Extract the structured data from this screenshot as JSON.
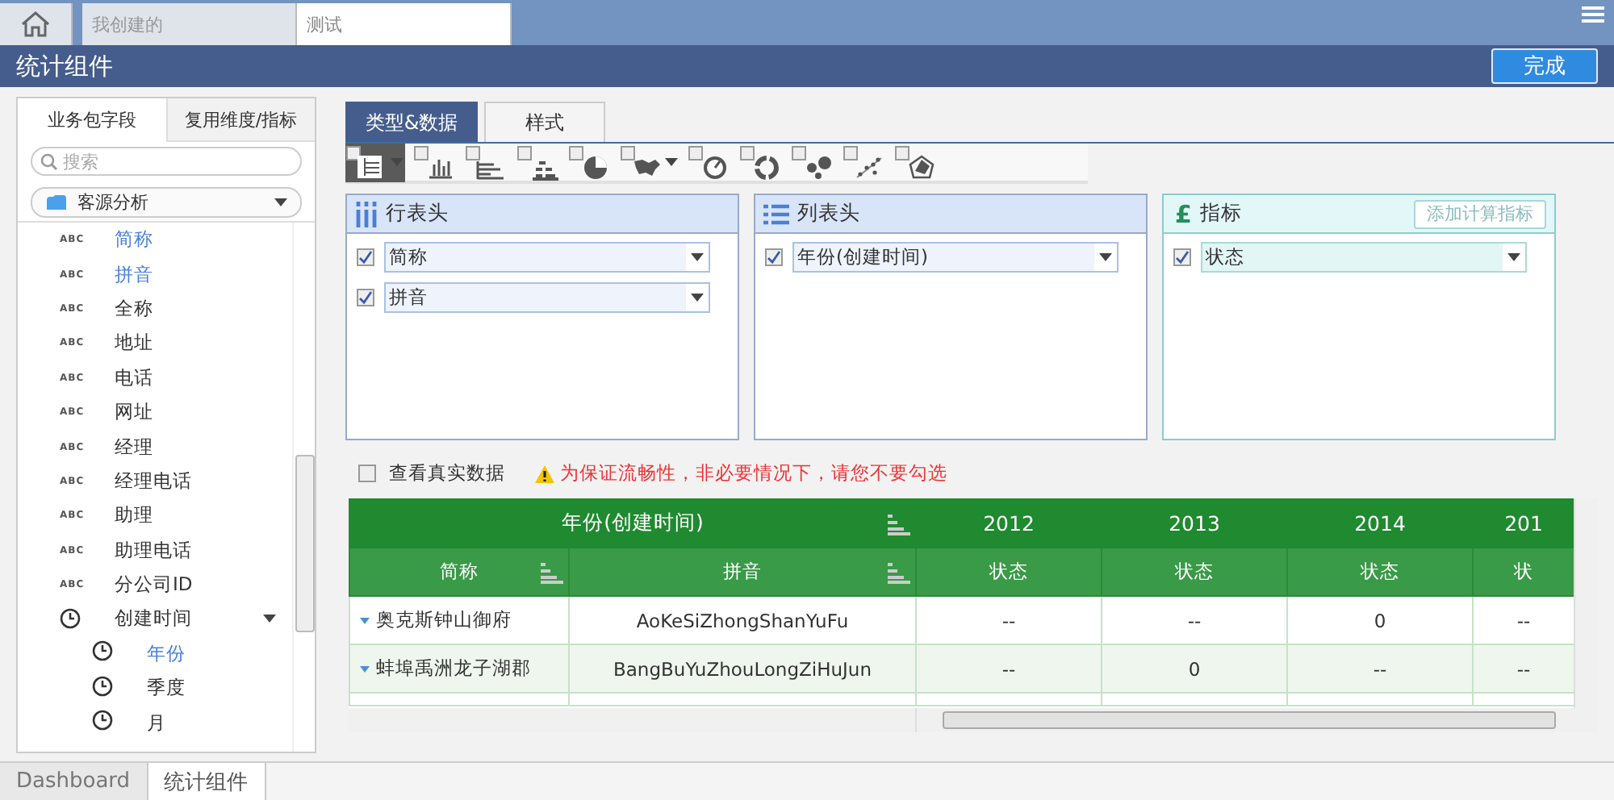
{
  "top_tabs": [
    {
      "kind": "home",
      "selected": false
    },
    {
      "kind": "page",
      "label": "我创建的",
      "selected": false
    },
    {
      "kind": "page",
      "label": "测试",
      "selected": true
    }
  ],
  "title": "统计组件",
  "done_button": "完成",
  "sidebar": {
    "tabs": [
      {
        "label": "业务包字段",
        "selected": true
      },
      {
        "label": "复用维度/指标",
        "selected": false
      }
    ],
    "search": {
      "placeholder": "搜索"
    },
    "package": "客源分析",
    "fields": [
      {
        "kind": "text",
        "badge": "ABC",
        "label": "简称",
        "selected": true
      },
      {
        "kind": "text",
        "badge": "ABC",
        "label": "拼音",
        "selected": true
      },
      {
        "kind": "text",
        "badge": "ABC",
        "label": "全称",
        "selected": false
      },
      {
        "kind": "text",
        "badge": "ABC",
        "label": "地址",
        "selected": false
      },
      {
        "kind": "text",
        "badge": "ABC",
        "label": "电话",
        "selected": false
      },
      {
        "kind": "text",
        "badge": "ABC",
        "label": "网址",
        "selected": false
      },
      {
        "kind": "text",
        "badge": "ABC",
        "label": "经理",
        "selected": false
      },
      {
        "kind": "text",
        "badge": "ABC",
        "label": "经理电话",
        "selected": false
      },
      {
        "kind": "text",
        "badge": "ABC",
        "label": "助理",
        "selected": false
      },
      {
        "kind": "text",
        "badge": "ABC",
        "label": "助理电话",
        "selected": false
      },
      {
        "kind": "text",
        "badge": "ABC",
        "label": "分公司ID",
        "selected": false
      },
      {
        "kind": "date",
        "label": "创建时间",
        "selected": false,
        "expanded": true,
        "children": [
          {
            "kind": "date",
            "label": "年份",
            "selected": true
          },
          {
            "kind": "date",
            "label": "季度",
            "selected": false
          },
          {
            "kind": "date",
            "label": "月",
            "selected": false
          }
        ]
      }
    ]
  },
  "editor": {
    "tabs": [
      {
        "label": "类型&数据",
        "selected": true
      },
      {
        "label": "样式",
        "selected": false
      }
    ],
    "chart_types": [
      {
        "kind": "table",
        "selected": true,
        "menu": true
      },
      {
        "kind": "bar",
        "selected": false,
        "menu": false
      },
      {
        "kind": "hbar",
        "selected": false,
        "menu": false
      },
      {
        "kind": "stacked",
        "selected": false,
        "menu": false
      },
      {
        "kind": "pie",
        "selected": false,
        "menu": false
      },
      {
        "kind": "map",
        "selected": false,
        "menu": true
      },
      {
        "kind": "gauge",
        "selected": false,
        "menu": false
      },
      {
        "kind": "donut",
        "selected": false,
        "menu": false
      },
      {
        "kind": "bubble",
        "selected": false,
        "menu": false
      },
      {
        "kind": "scatter",
        "selected": false,
        "menu": false
      },
      {
        "kind": "radar",
        "selected": false,
        "menu": false
      }
    ],
    "regions": [
      {
        "kind": "rows",
        "title": "行表头",
        "items": [
          {
            "label": "简称",
            "checked": true
          },
          {
            "label": "拼音",
            "checked": true
          }
        ]
      },
      {
        "kind": "columns",
        "title": "列表头",
        "items": [
          {
            "label": "年份(创建时间)",
            "checked": true
          }
        ]
      },
      {
        "kind": "measures",
        "symbol": "£",
        "title": "指标",
        "action": "添加计算指标",
        "items": [
          {
            "label": "状态",
            "checked": true
          }
        ]
      }
    ],
    "real_data": {
      "label": "查看真实数据",
      "checked": false,
      "warning": "为保证流畅性，非必要情况下，请您不要勾选"
    },
    "table": {
      "corner": "年份(创建时间)",
      "years": [
        "2012",
        "2013",
        "2014",
        "201"
      ],
      "columns": [
        "简称",
        "拼音",
        "状态",
        "状态",
        "状态",
        "状"
      ],
      "rows": [
        {
          "cells": [
            "奥克斯钟山御府",
            "AoKeSiZhongShanYuFu",
            "--",
            "--",
            "0",
            "--"
          ]
        },
        {
          "cells": [
            "蚌埠禹洲龙子湖郡",
            "BangBuYuZhouLongZiHuJun",
            "--",
            "0",
            "--",
            "--"
          ]
        }
      ]
    }
  },
  "bottom_tabs": [
    {
      "label": "Dashboard",
      "selected": false
    },
    {
      "label": "统计组件",
      "selected": true
    }
  ]
}
